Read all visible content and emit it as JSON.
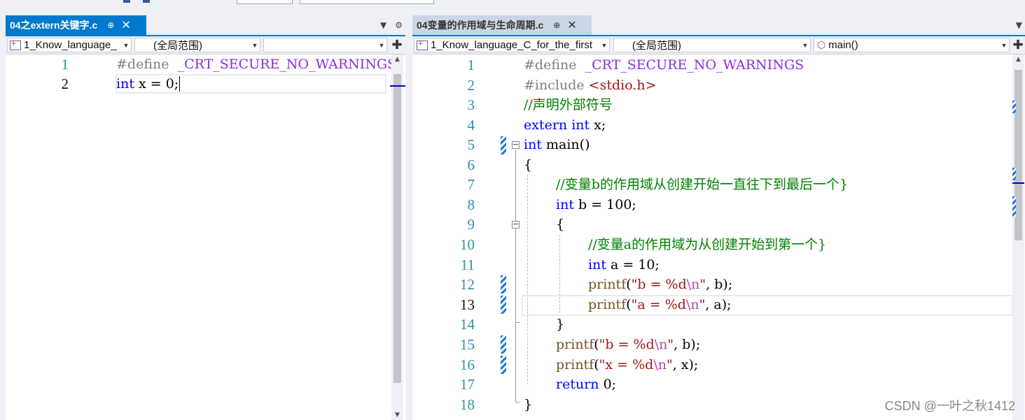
{
  "left_pane": {
    "tab": {
      "label": "04之extern关键字.c",
      "pin": "⊕",
      "close": "✕"
    },
    "nav": {
      "project": "1_Know_language_",
      "scope": "(全局范围)",
      "member": ""
    },
    "lines": [
      {
        "n": "1"
      },
      {
        "n": "2"
      }
    ]
  },
  "right_pane": {
    "tab": {
      "label": "04变量的作用域与生命周期.c",
      "pin": "⊕",
      "close": "✕"
    },
    "nav": {
      "project": "1_Know_language_C_for_the_first",
      "scope": "(全局范围)",
      "member": "main()"
    },
    "lines": [
      {
        "n": "1"
      },
      {
        "n": "2"
      },
      {
        "n": "3"
      },
      {
        "n": "4"
      },
      {
        "n": "5"
      },
      {
        "n": "6"
      },
      {
        "n": "7"
      },
      {
        "n": "8"
      },
      {
        "n": "9"
      },
      {
        "n": "10"
      },
      {
        "n": "11"
      },
      {
        "n": "12"
      },
      {
        "n": "13"
      },
      {
        "n": "14"
      },
      {
        "n": "15"
      },
      {
        "n": "16"
      },
      {
        "n": "17"
      },
      {
        "n": "18"
      }
    ]
  },
  "code_left": {
    "l1_kw": "#define",
    "l1_macro": "_CRT_SECURE_NO_WARNINGS",
    "l2_kw": "int",
    "l2_rest": " x = 0;"
  },
  "code_right": {
    "l1_kw": "#define",
    "l1_macro": "_CRT_SECURE_NO_WARNINGS",
    "l2_kw": "#include",
    "l2_hdr": "<stdio.h>",
    "l3_cmt": "//声明外部符号",
    "l4_kw1": "extern",
    "l4_kw2": "int",
    "l4_rest": " x;",
    "l5_kw": "int",
    "l5_rest": " main()",
    "l6": "{",
    "l7_cmt": "//变量b的作用域从创建开始一直往下到最后一个}",
    "l8_kw": "int",
    "l8_rest": " b = 100;",
    "l9": "{",
    "l10_cmt": "//变量a的作用域为从创建开始到第一个}",
    "l11_kw": "int",
    "l11_rest": " a = 10;",
    "l12_fn": "printf",
    "l12_open": "(",
    "l12_str1": "\"b = %d",
    "l12_esc": "\\n",
    "l12_str2": "\"",
    "l12_rest": ", b);",
    "l13_fn": "printf",
    "l13_open": "(",
    "l13_str1": "\"a = %d",
    "l13_esc": "\\n",
    "l13_str2": "\"",
    "l13_rest": ", a);",
    "l14": "}",
    "l15_fn": "printf",
    "l15_open": "(",
    "l15_str1": "\"b = %d",
    "l15_esc": "\\n",
    "l15_str2": "\"",
    "l15_rest": ", b);",
    "l16_fn": "printf",
    "l16_open": "(",
    "l16_str1": "\"x = %d",
    "l16_esc": "\\n",
    "l16_str2": "\"",
    "l16_rest": ", x);",
    "l17_kw": "return",
    "l17_rest": " 0;",
    "l18": "}"
  },
  "watermark": "CSDN @一叶之秋1412",
  "colors": {
    "accent": "#007acc",
    "keyword": "#0000ff",
    "comment": "#008000",
    "string": "#a31515",
    "macro": "#8a2be2",
    "line_number": "#2b91af"
  }
}
